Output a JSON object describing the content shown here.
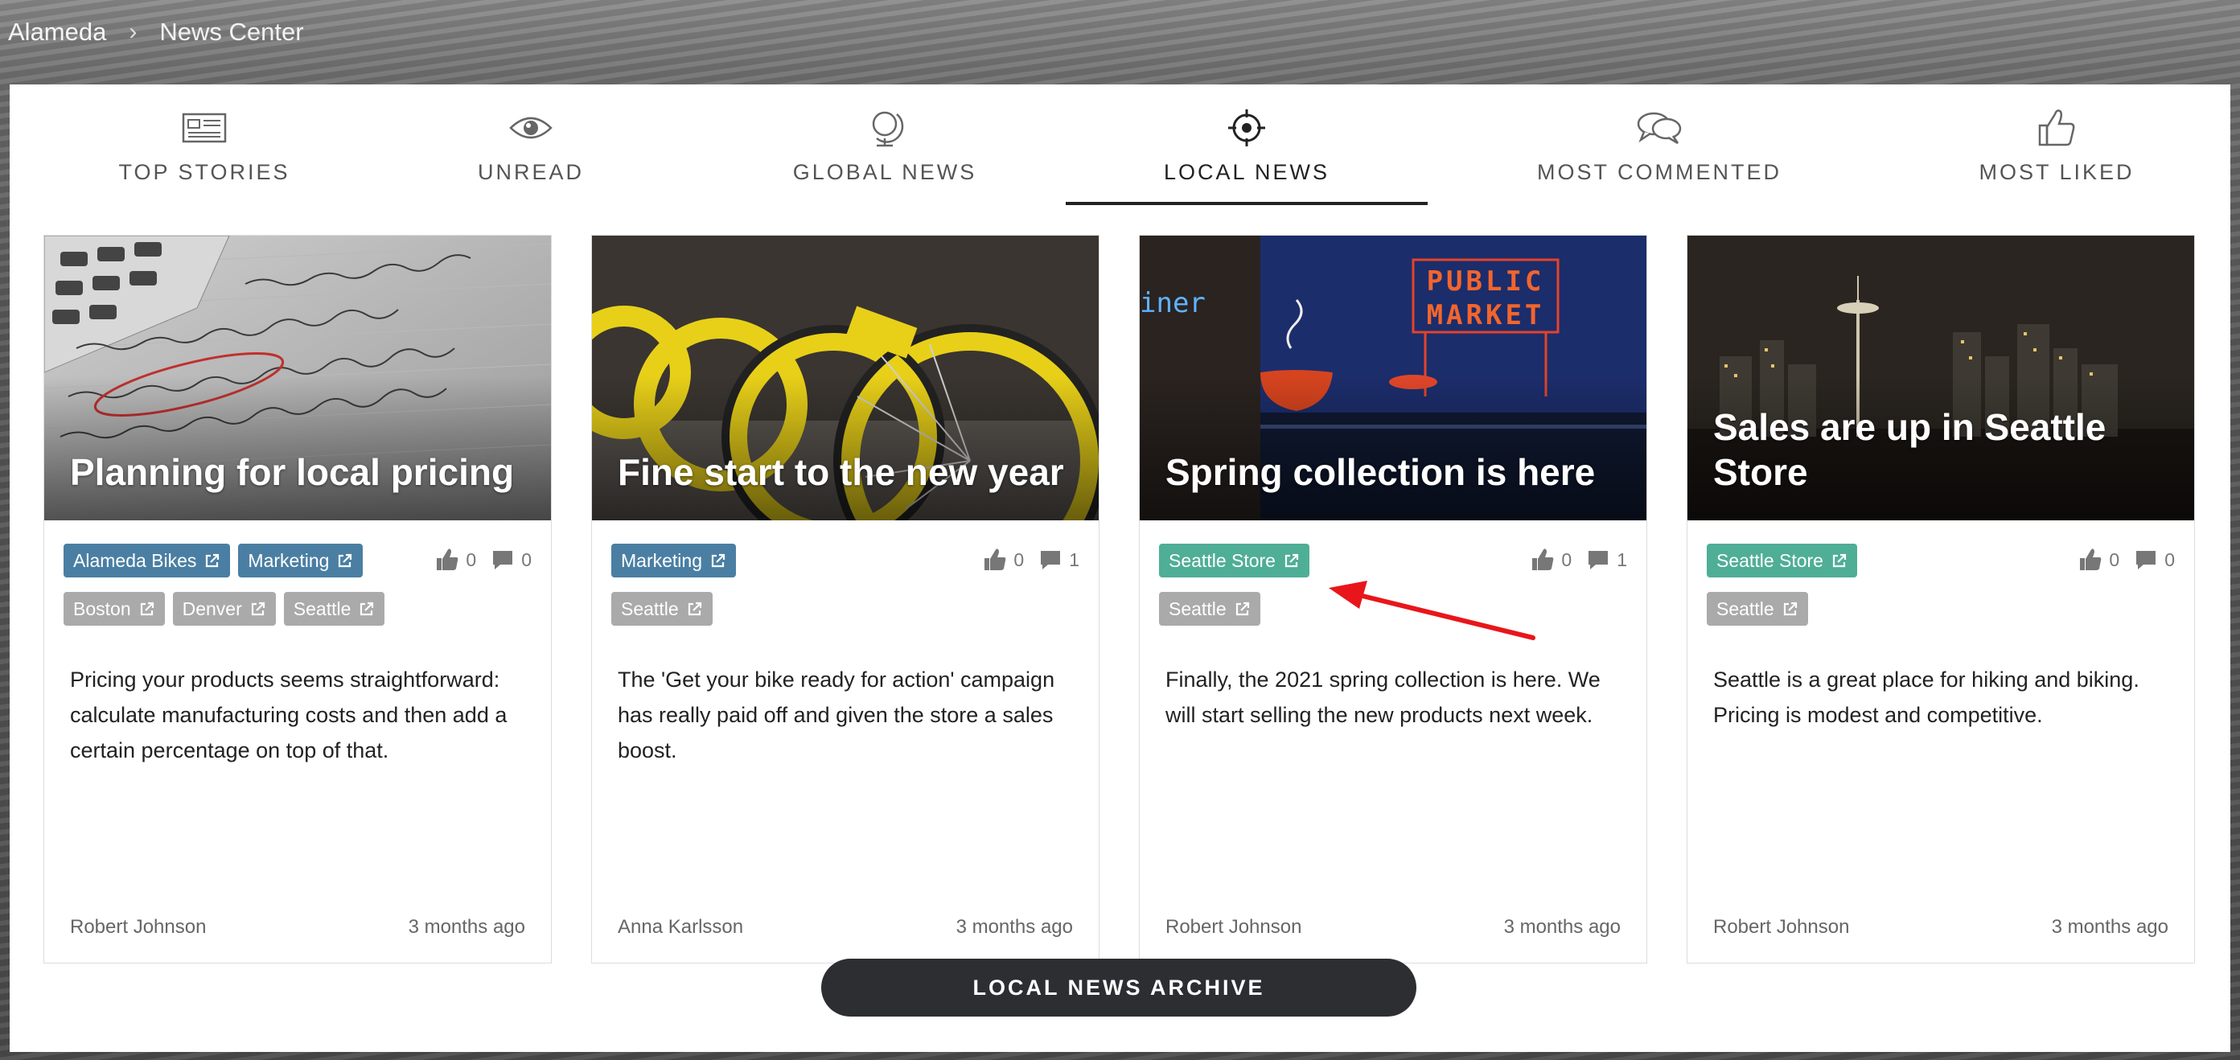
{
  "breadcrumb": {
    "root": "Alameda",
    "separator": "›",
    "current": "News Center"
  },
  "tabs": [
    {
      "label": "TOP STORIES",
      "icon": "newspaper-icon"
    },
    {
      "label": "UNREAD",
      "icon": "eye-icon"
    },
    {
      "label": "GLOBAL NEWS",
      "icon": "globe-icon"
    },
    {
      "label": "LOCAL NEWS",
      "icon": "crosshair-icon",
      "active": true
    },
    {
      "label": "MOST COMMENTED",
      "icon": "chat-bubbles-icon"
    },
    {
      "label": "MOST LIKED",
      "icon": "thumbs-up-icon"
    }
  ],
  "cards": [
    {
      "title": "Planning for local pricing",
      "tags": [
        {
          "label": "Alameda Bikes",
          "color": "#4a7fa3"
        },
        {
          "label": "Marketing",
          "color": "#4a7fa3"
        },
        {
          "label": "Boston",
          "color": "#aaaaaa"
        },
        {
          "label": "Denver",
          "color": "#aaaaaa"
        },
        {
          "label": "Seattle",
          "color": "#aaaaaa"
        }
      ],
      "likes": "0",
      "comments": "0",
      "excerpt": "Pricing your products seems straightforward: calculate manufacturing costs and then add a certain percentage on top of that.",
      "author": "Robert Johnson",
      "time": "3 months ago"
    },
    {
      "title": "Fine start to the new year",
      "tags": [
        {
          "label": "Marketing",
          "color": "#4a7fa3"
        },
        {
          "label": "Seattle",
          "color": "#aaaaaa"
        }
      ],
      "likes": "0",
      "comments": "1",
      "excerpt": "The 'Get your bike ready for action' campaign has really paid off and given the store a sales boost.",
      "author": "Anna Karlsson",
      "time": "3 months ago"
    },
    {
      "title": "Spring collection is here",
      "tags": [
        {
          "label": "Seattle Store",
          "color": "#4fae96"
        },
        {
          "label": "Seattle",
          "color": "#aaaaaa"
        }
      ],
      "likes": "0",
      "comments": "1",
      "excerpt": "Finally, the 2021 spring collection is here. We will start selling the new products next week.",
      "author": "Robert Johnson",
      "time": "3 months ago"
    },
    {
      "title": "Sales are up in Seattle Store",
      "tags": [
        {
          "label": "Seattle Store",
          "color": "#4fae96"
        },
        {
          "label": "Seattle",
          "color": "#aaaaaa"
        }
      ],
      "likes": "0",
      "comments": "0",
      "excerpt": "Seattle is a great place for hiking and biking. Pricing is modest and competitive.",
      "author": "Robert Johnson",
      "time": "3 months ago"
    }
  ],
  "archive_button": "LOCAL NEWS ARCHIVE",
  "image_text": {
    "public_market": "PUBLIC MARKET",
    "diner": "iner"
  },
  "colors": {
    "accent_blue": "#4a7fa3",
    "accent_green": "#4fae96",
    "tag_gray": "#aaaaaa",
    "button_dark": "#2c2e32",
    "annotation_arrow": "#e8161b"
  }
}
